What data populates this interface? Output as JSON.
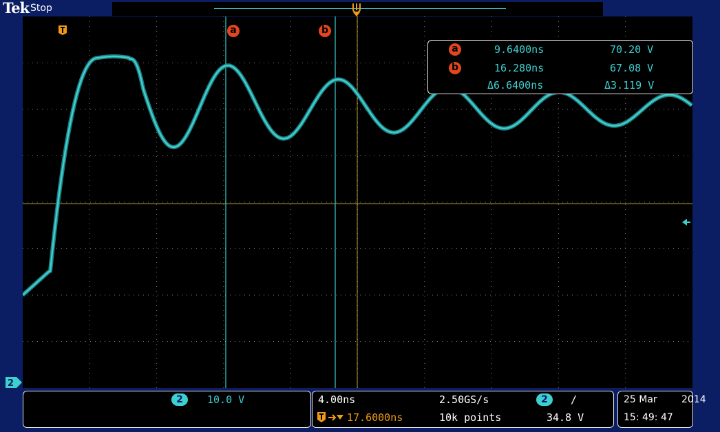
{
  "header": {
    "brand": "Tek",
    "acquisition_status": "Stop"
  },
  "markers": {
    "trigger_icon": "trigger-T-icon",
    "cursor_a": "a",
    "cursor_b": "b",
    "channel_ground": "2"
  },
  "cursor_readout": {
    "a_label": "a",
    "a_time": "9.6400ns",
    "a_value": "70.20 V",
    "b_label": "b",
    "b_time": "16.280ns",
    "b_value": "67.08 V",
    "delta_time": "Δ6.6400ns",
    "delta_value": "Δ3.119 V"
  },
  "channel_panel": {
    "channel": "2",
    "scale": "10.0 V"
  },
  "timebase_panel": {
    "horizontal_scale": "4.00ns",
    "sample_rate": "2.50GS/s",
    "trigger_delay": "17.6000ns",
    "record_length": "10k points",
    "trigger_channel": "2",
    "trigger_slope": "/",
    "trigger_level": "34.8 V"
  },
  "datetime_panel": {
    "date": "25 Mar",
    "year": "2014",
    "time": "15: 49: 47"
  },
  "colors": {
    "frame": "#0b1d63",
    "screen": "#000000",
    "trace": "#3ecfd0",
    "grid": "#7a7a7a",
    "crosshair": "#b39a3a",
    "cursor_badge": "#e2461e",
    "trigger": "#f29a17"
  }
}
